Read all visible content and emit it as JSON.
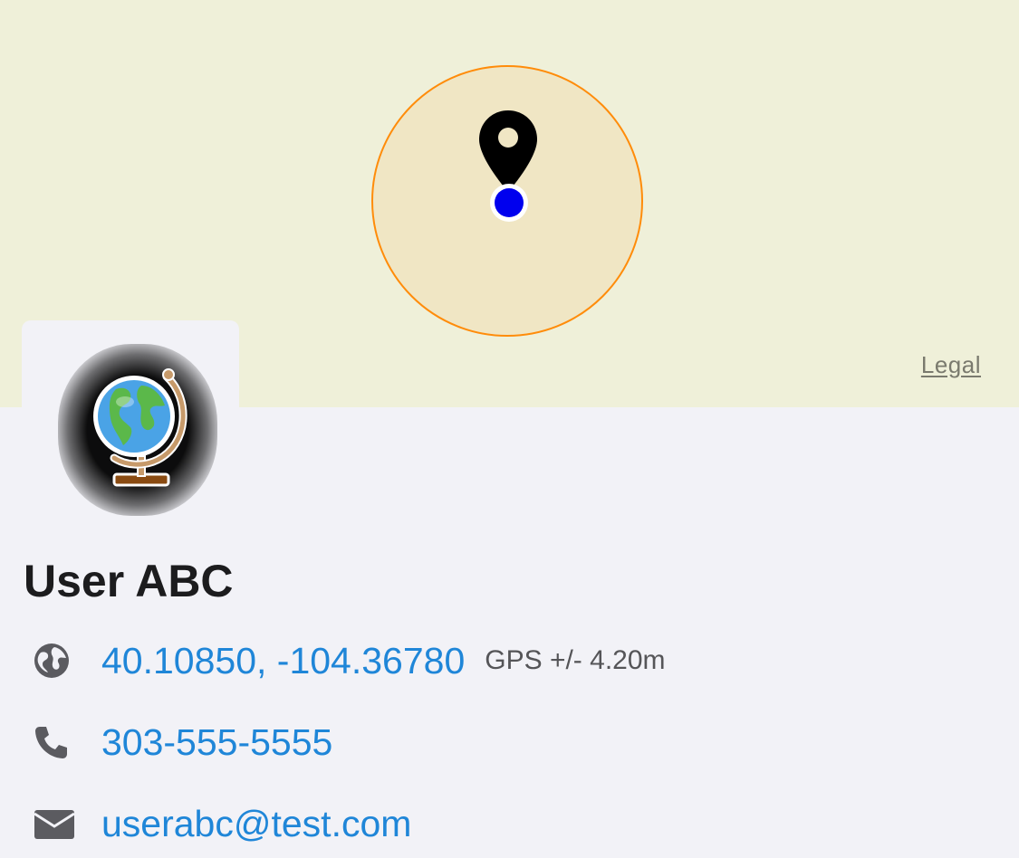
{
  "map": {
    "legal_label": "Legal",
    "colors": {
      "background": "#eff0d9",
      "accuracy_fill": "#f0e6c4",
      "accuracy_stroke": "#ff8c0a",
      "location_dot": "#0000ee"
    },
    "marker_icon": "map-pin-icon"
  },
  "profile": {
    "avatar_icon": "globe-icon",
    "name": "User ABC",
    "coordinates": "40.10850, -104.36780",
    "gps_accuracy": "GPS +/- 4.20m",
    "phone": "303-555-5555",
    "email": "userabc@test.com",
    "icons": {
      "coordinates": "globe-americas-icon",
      "phone": "phone-icon",
      "email": "envelope-icon"
    },
    "link_color": "#1f86d8"
  }
}
